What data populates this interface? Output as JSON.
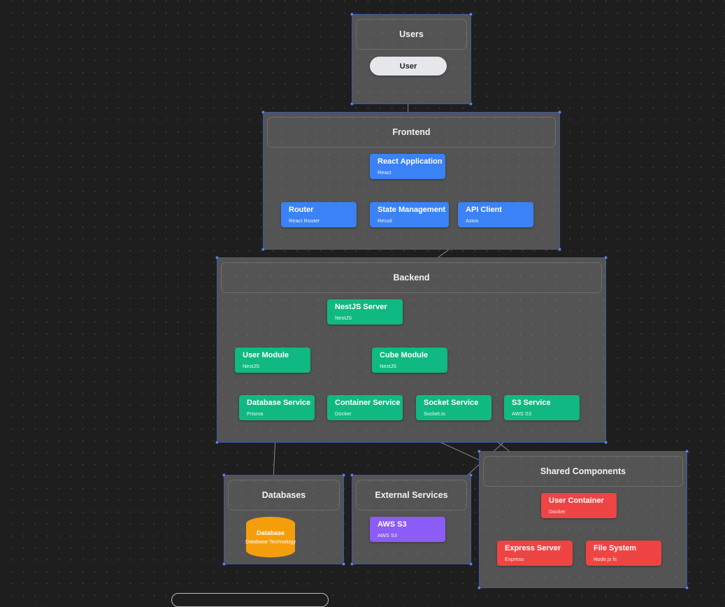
{
  "colors": {
    "frontend": "#3b82f6",
    "backend": "#10b981",
    "external": "#8b5cf6",
    "shared": "#ef4444",
    "database": "#f59e0b",
    "user": "#e5e7eb",
    "edge": "#8a8a8a"
  },
  "groups": [
    {
      "id": "users",
      "label": "Users"
    },
    {
      "id": "frontend",
      "label": "Frontend"
    },
    {
      "id": "backend",
      "label": "Backend"
    },
    {
      "id": "databases",
      "label": "Databases"
    },
    {
      "id": "external",
      "label": "External Services"
    },
    {
      "id": "shared",
      "label": "Shared Components"
    }
  ],
  "nodes": {
    "user": {
      "title": "User"
    },
    "react_app": {
      "title": "React Application",
      "sub": "React"
    },
    "router": {
      "title": "Router",
      "sub": "React Router"
    },
    "state_mgmt": {
      "title": "State Management",
      "sub": "Recoil"
    },
    "api_client": {
      "title": "API Client",
      "sub": "Axios"
    },
    "nestjs_server": {
      "title": "NestJS Server",
      "sub": "NestJS"
    },
    "user_module": {
      "title": "User Module",
      "sub": "NestJS"
    },
    "cube_module": {
      "title": "Cube Module",
      "sub": "NestJS"
    },
    "database_service": {
      "title": "Database Service",
      "sub": "Prisma"
    },
    "container_service": {
      "title": "Container Service",
      "sub": "Docker"
    },
    "socket_service": {
      "title": "Socket Service",
      "sub": "Socket.io"
    },
    "s3_service": {
      "title": "S3 Service",
      "sub": "AWS S3"
    },
    "database": {
      "title": "Database",
      "sub": "Database Technology"
    },
    "aws_s3": {
      "title": "AWS S3",
      "sub": "AWS S3"
    },
    "user_container": {
      "title": "User Container",
      "sub": "Docker"
    },
    "express_server": {
      "title": "Express Server",
      "sub": "Express"
    },
    "file_system": {
      "title": "File System",
      "sub": "Node.js fs"
    }
  },
  "edges": [
    [
      "user",
      "react_app"
    ],
    [
      "react_app",
      "router"
    ],
    [
      "react_app",
      "state_mgmt"
    ],
    [
      "react_app",
      "api_client"
    ],
    [
      "api_client",
      "nestjs_server"
    ],
    [
      "nestjs_server",
      "user_module"
    ],
    [
      "nestjs_server",
      "cube_module"
    ],
    [
      "user_module",
      "database_service"
    ],
    [
      "cube_module",
      "database_service"
    ],
    [
      "cube_module",
      "container_service"
    ],
    [
      "cube_module",
      "socket_service"
    ],
    [
      "cube_module",
      "s3_service"
    ],
    [
      "database_service",
      "database"
    ],
    [
      "s3_service",
      "aws_s3"
    ],
    [
      "container_service",
      "user_container"
    ],
    [
      "socket_service",
      "user_container"
    ],
    [
      "user_container",
      "express_server"
    ],
    [
      "user_container",
      "file_system"
    ]
  ]
}
